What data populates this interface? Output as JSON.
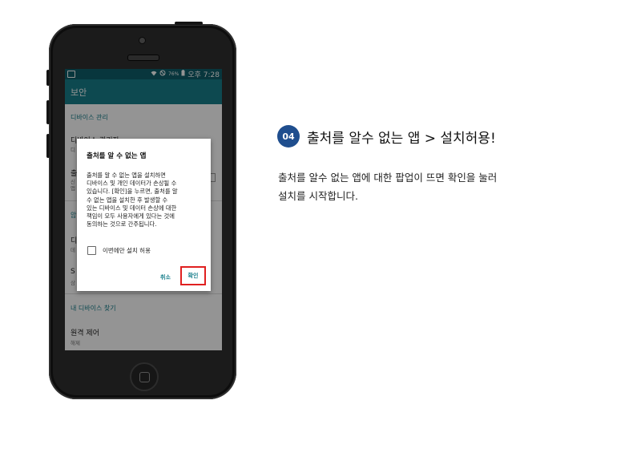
{
  "phone": {
    "status_bar": {
      "battery": "76%",
      "time": "오후 7:28"
    },
    "app_bar": {
      "title": "보안"
    },
    "settings": {
      "section_device_admin": "디바이스 관리",
      "item_device_admin_partial": "디바이스 관리자",
      "item_device_admin_sub": "디",
      "item_unknown_partial": "출",
      "item_unknown_sub1": "신",
      "item_unknown_sub2": "앱",
      "section_partial": "암",
      "item_partial_3": "디",
      "item_partial_3_sub": "데",
      "item_partial_4": "S",
      "item_partial_4_sub": "삼",
      "section_find_device": "내 디바이스 찾기",
      "item_remote": "원격 제어",
      "item_remote_sub": "해제"
    },
    "dialog": {
      "title": "출처를 알 수 없는 앱",
      "body": "출처를 알 수 없는 앱을 설치하면\n디바이스 및 개인 데이터가 손상될 수\n있습니다. [확인]을 누르면, 출처를 알\n수 없는 앱을 설치한 후 발생할 수\n있는 디바이스 및 데이터 손상에 대한\n책임이 모두 사용자에게 있다는 것에\n동의하는 것으로 간주됩니다.",
      "checkbox_label": "이번에만 설치 허용",
      "cancel_label": "취소",
      "ok_label": "확인"
    }
  },
  "annotation": {
    "step_number": "04",
    "step_title": "출처를 알수 없는 앱 > 설치허용!",
    "desc_line1": "출처를 알수 없는 앱에 대한 팝업이 뜨면 확인을 눌러",
    "desc_line2": "설치를 시작합니다."
  },
  "colors": {
    "status_bar": "#0f5e69",
    "app_bar": "#187e8b",
    "accent": "#187e8b",
    "highlight": "#e02020",
    "badge": "#1f4e8e"
  }
}
